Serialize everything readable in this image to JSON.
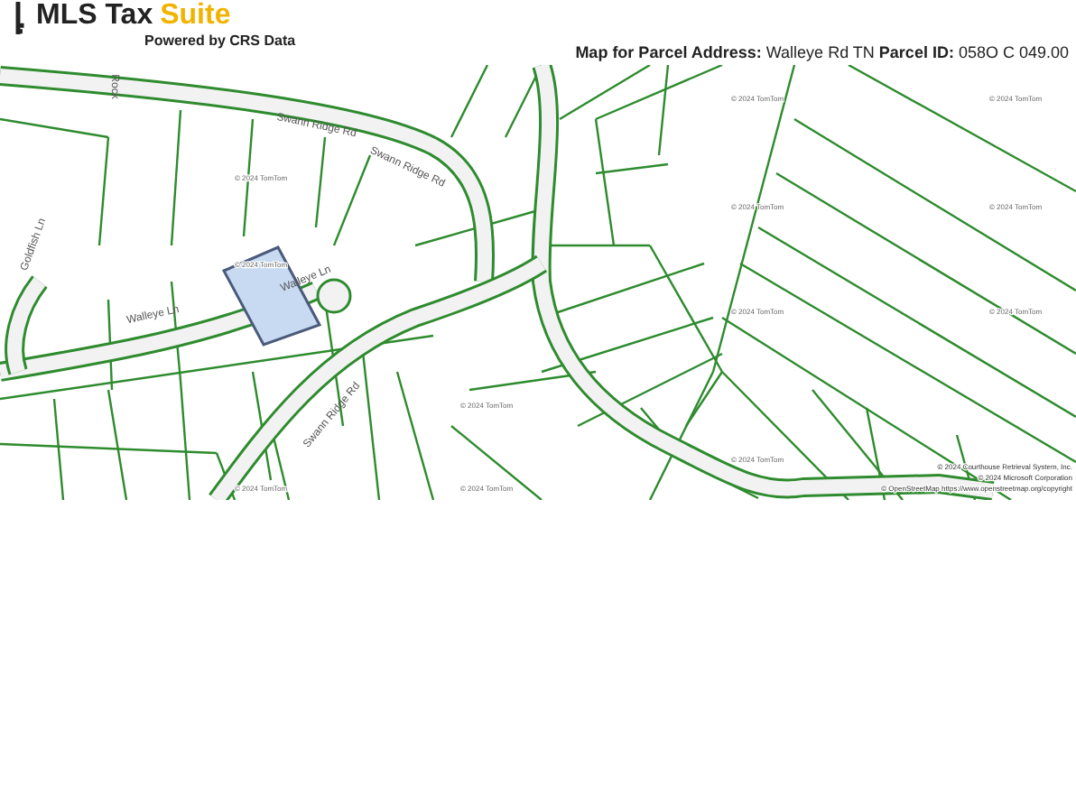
{
  "header": {
    "logo": {
      "brand": "MLS Tax",
      "accent": "Suite",
      "tagline": "Powered by CRS Data"
    },
    "title": "**Map for Parcel Address:** Walleye Rd TN **Parcel ID:** 058O C 049.00"
  },
  "map": {
    "street_labels": [
      "Swann Ridge Rd",
      "Swann Ridge Rd",
      "Swann Ridge Rd",
      "Walleye Ln",
      "Walleye Ln",
      "Goldfish Ln",
      "Rock"
    ],
    "watermarks": [
      "© 2024 TomTom",
      "© 2024 TomTom",
      "© 2024 TomTom",
      "© 2024 TomTom",
      "© 2024 TomTom",
      "© 2024 TomTom",
      "© 2024 TomTom",
      "© 2024 TomTom",
      "© 2024 TomTom",
      "© 2024 TomTom",
      "© 2024 TomTom",
      "© 2024 TomTom"
    ],
    "attribution": [
      "© 2024 Courthouse Retrieval System, Inc.",
      "© 2024 Microsoft Corporation",
      "© OpenStreetMap https://www.openstreetmap.org/copyright"
    ]
  }
}
